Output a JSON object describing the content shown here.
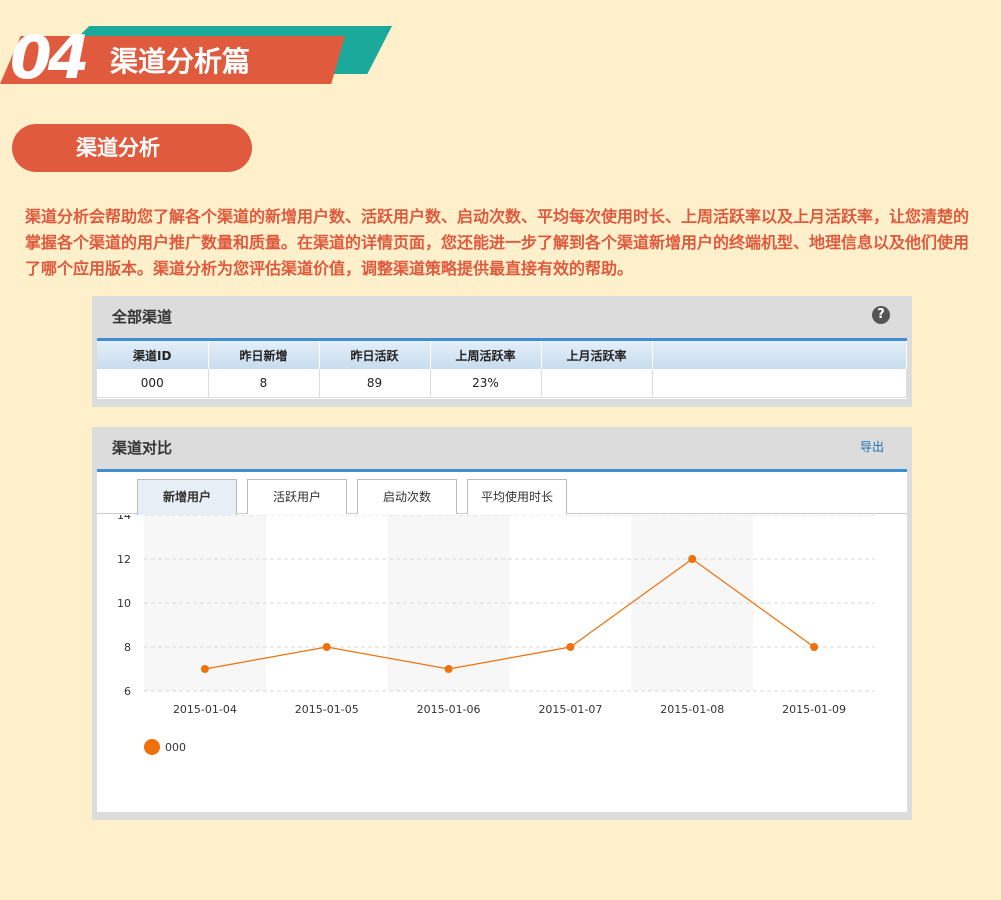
{
  "section": {
    "number": "04",
    "title": "渠道分析篇"
  },
  "subsection": {
    "label": "渠道分析"
  },
  "description": "渠道分析会帮助您了解各个渠道的新增用户数、活跃用户数、启动次数、平均每次使用时长、上周活跃率以及上月活跃率，让您清楚的掌握各个渠道的用户推广数量和质量。在渠道的详情页面，您还能进一步了解到各个渠道新增用户的终端机型、地理信息以及他们使用了哪个应用版本。渠道分析为您评估渠道价值，调整渠道策略提供最直接有效的帮助。",
  "all_channels": {
    "title": "全部渠道",
    "help": "?",
    "columns": [
      "渠道ID",
      "昨日新增",
      "昨日活跃",
      "上周活跃率",
      "上月活跃率",
      ""
    ],
    "rows": [
      [
        "000",
        "8",
        "89",
        "23%",
        "",
        ""
      ]
    ]
  },
  "compare": {
    "title": "渠道对比",
    "export_label": "导出",
    "tabs": [
      "新增用户",
      "活跃用户",
      "启动次数",
      "平均使用时长"
    ],
    "active_tab": 0
  },
  "colors": {
    "accent": "#e05a3e",
    "teal": "#1aa99b",
    "series": "#f0700a"
  },
  "chart_data": {
    "type": "line",
    "x": [
      "2015-01-04",
      "2015-01-05",
      "2015-01-06",
      "2015-01-07",
      "2015-01-08",
      "2015-01-09"
    ],
    "series": [
      {
        "name": "000",
        "values": [
          7,
          8,
          7,
          8,
          12,
          8
        ]
      }
    ],
    "ylim": [
      6,
      14
    ],
    "yticks": [
      6,
      8,
      10,
      12,
      14
    ],
    "grid": true,
    "legend": "bottom-left"
  }
}
